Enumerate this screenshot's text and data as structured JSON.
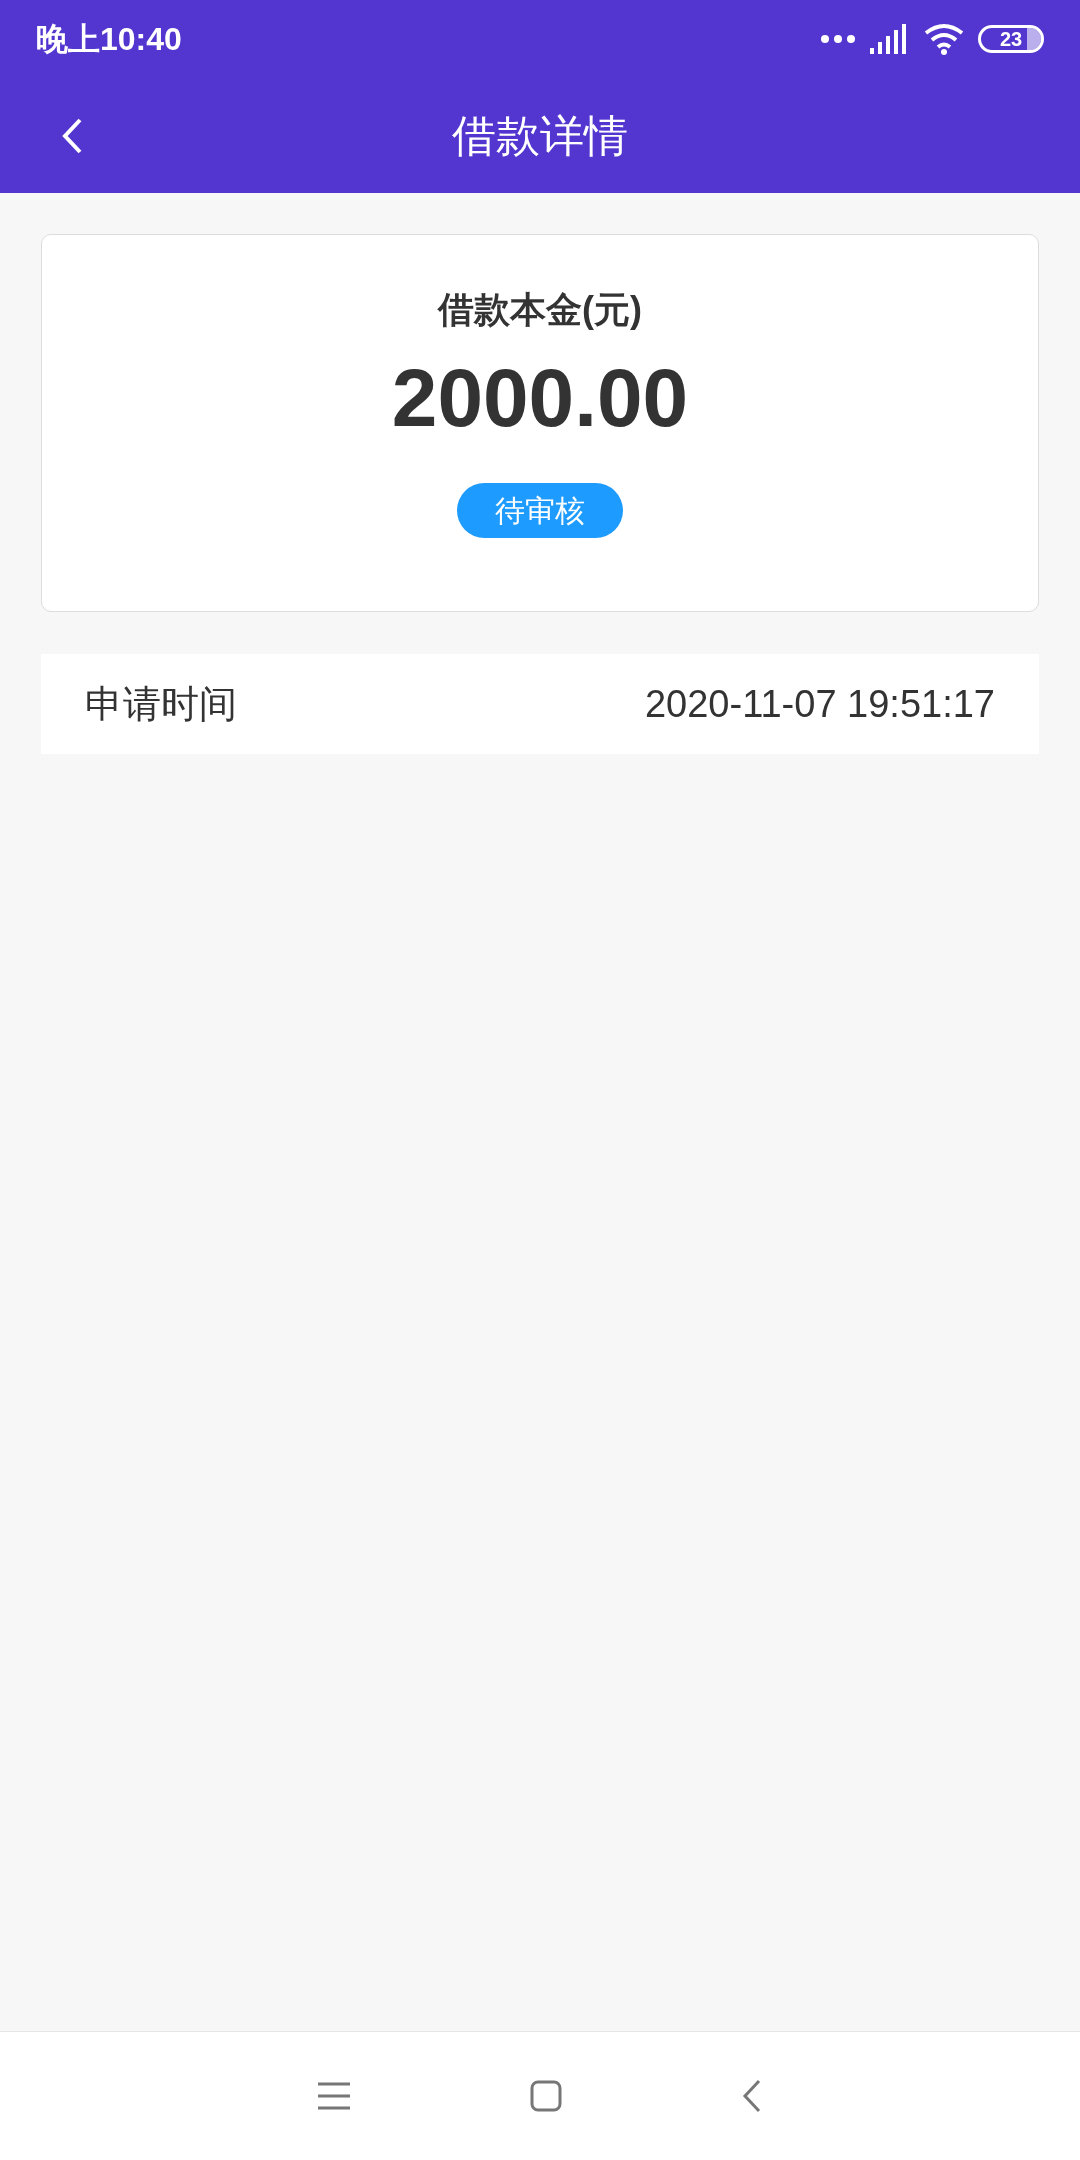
{
  "status_bar": {
    "time": "晚上10:40",
    "battery": "23"
  },
  "header": {
    "title": "借款详情"
  },
  "card": {
    "label": "借款本金(元)",
    "amount": "2000.00",
    "status": "待审核"
  },
  "details": [
    {
      "label": "申请时间",
      "value": "2020-11-07 19:51:17"
    }
  ]
}
